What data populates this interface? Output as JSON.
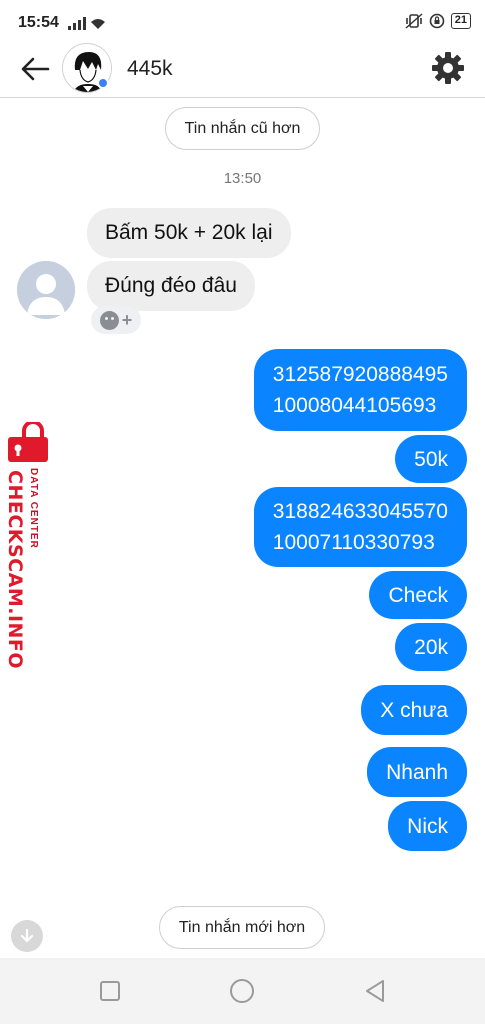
{
  "status_bar": {
    "time": "15:54",
    "battery": "21",
    "icons": [
      "signal-icon",
      "wifi-icon",
      "vibrate-icon",
      "alarm-icon",
      "battery-icon"
    ]
  },
  "header": {
    "title": "445k",
    "icons": [
      "back-arrow-icon",
      "verified-badge-icon",
      "gear-icon"
    ]
  },
  "conversation": {
    "older_label": "Tin nhắn cũ hơn",
    "timestamp": "13:50",
    "incoming": [
      "Bấm 50k + 20k lại",
      "Đúng đéo đâu"
    ],
    "outgoing": [
      {
        "lines": [
          "312587920888495",
          "10008044105693"
        ]
      },
      {
        "lines": [
          "50k"
        ]
      },
      {
        "lines": [
          "318824633045570",
          "10007110330793"
        ]
      },
      {
        "lines": [
          "Check"
        ]
      },
      {
        "lines": [
          "20k"
        ]
      },
      {
        "lines": [
          "X chưa"
        ]
      },
      {
        "lines": [
          "Nhanh"
        ]
      },
      {
        "lines": [
          "Nick"
        ]
      }
    ],
    "newer_label": "Tin nhắn mới hơn"
  },
  "watermark": {
    "main": "CHECKSCAM.INFO",
    "sub": "DATA CENTER"
  },
  "colors": {
    "outgoing_bubble": "#0a84ff",
    "incoming_bubble": "#eeeeee",
    "watermark": "#e0192d"
  }
}
